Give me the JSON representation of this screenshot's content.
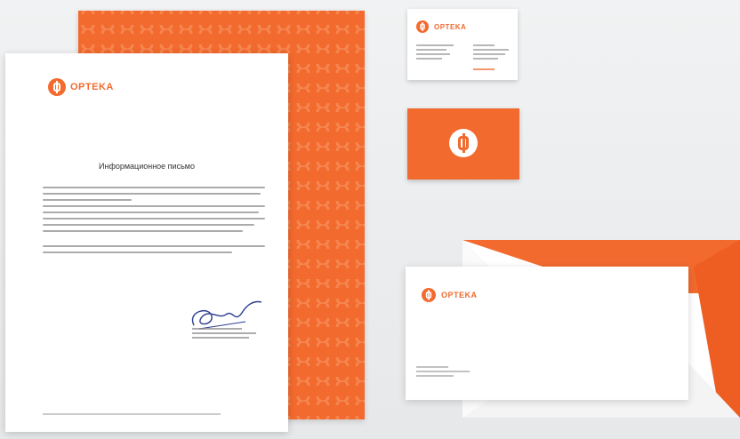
{
  "brand": {
    "name": "OPTEKA",
    "accent": "#f26a2e"
  },
  "letter": {
    "title": "Информационное письмо"
  },
  "colors": {
    "orange": "#f26a2e",
    "paper": "#ffffff",
    "background": "#eceeef"
  }
}
